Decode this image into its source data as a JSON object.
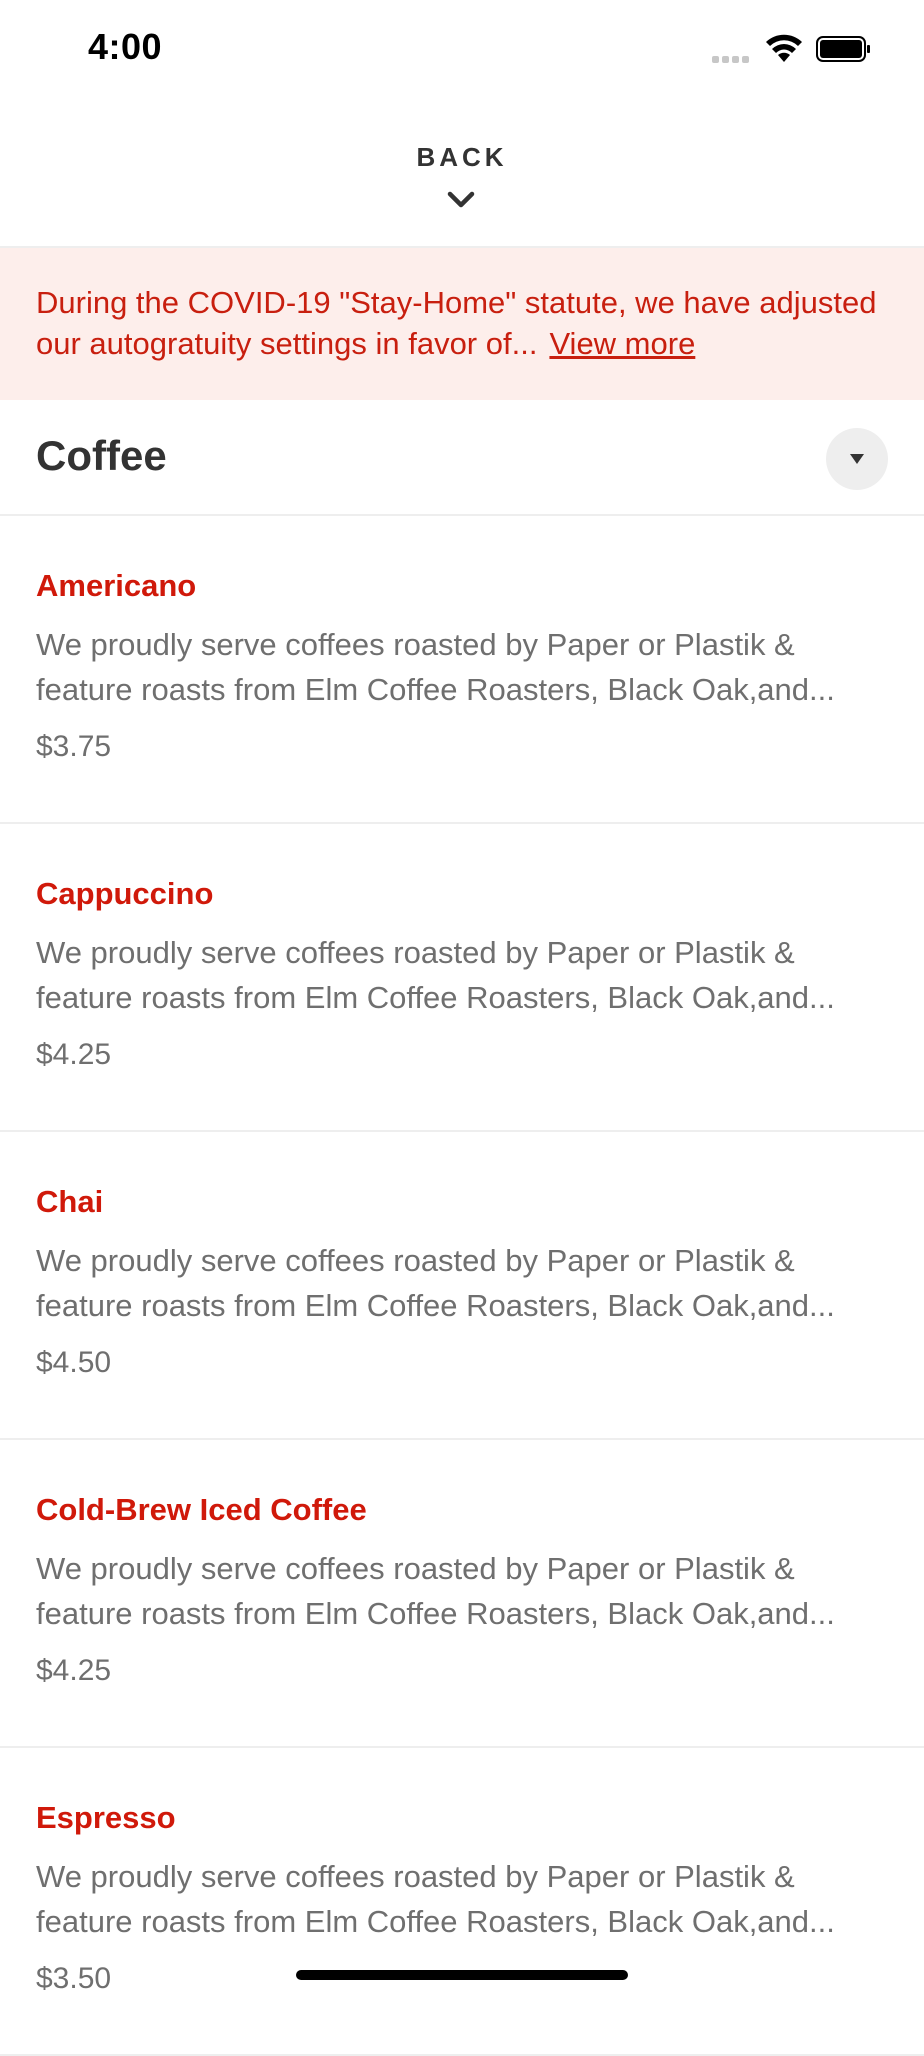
{
  "status_bar": {
    "time": "4:00"
  },
  "header": {
    "back_label": "BACK"
  },
  "notice": {
    "text": "During the COVID-19 \"Stay-Home\" statute, we have adjusted our autogratuity settings in favor of...",
    "link_label": "View more"
  },
  "category": {
    "title": "Coffee"
  },
  "items": [
    {
      "name": "Americano",
      "description": "We proudly serve coffees roasted by Paper or Plastik & feature roasts from Elm Coffee Roasters, Black Oak,and...",
      "price": "$3.75"
    },
    {
      "name": "Cappuccino",
      "description": "We proudly serve coffees roasted by Paper or Plastik & feature roasts from Elm Coffee Roasters, Black Oak,and...",
      "price": "$4.25"
    },
    {
      "name": "Chai",
      "description": "We proudly serve coffees roasted by Paper or Plastik & feature roasts from Elm Coffee Roasters, Black Oak,and...",
      "price": "$4.50"
    },
    {
      "name": "Cold-Brew Iced Coffee",
      "description": "We proudly serve coffees roasted by Paper or Plastik & feature roasts from Elm Coffee Roasters, Black Oak,and...",
      "price": "$4.25"
    },
    {
      "name": "Espresso",
      "description": "We proudly serve coffees roasted by Paper or Plastik & feature roasts from Elm Coffee Roasters, Black Oak,and...",
      "price": "$3.50"
    }
  ],
  "colors": {
    "accent": "#d0190a",
    "notice_bg": "#fdeeeb",
    "text_muted": "#6f6f6f"
  },
  "icons": [
    "signal-icon",
    "wifi-icon",
    "battery-icon",
    "chevron-down-icon",
    "dropdown-caret-icon"
  ]
}
